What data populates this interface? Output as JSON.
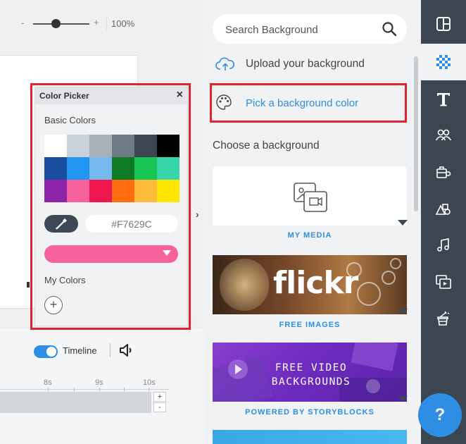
{
  "zoom": {
    "minus": "-",
    "plus": "+",
    "value": "100%",
    "level": 0.4
  },
  "color_picker": {
    "title": "Color Picker",
    "close": "×",
    "basic_colors_label": "Basic Colors",
    "swatches": [
      "#ffffff",
      "#c9d1d9",
      "#a7b1ba",
      "#6e7b86",
      "#3b4650",
      "#000000",
      "#1b4ea0",
      "#2196f3",
      "#74b8ee",
      "#0f7a25",
      "#18c552",
      "#37d6a8",
      "#8e24aa",
      "#f7629c",
      "#f0174e",
      "#ff6d10",
      "#ffbb3c",
      "#ffe600"
    ],
    "hex_value": "#F7629C",
    "selected_color": "#f7629c",
    "my_colors_label": "My Colors",
    "add": "+"
  },
  "timeline": {
    "label": "Timeline",
    "enabled": true,
    "ticks": [
      "8s",
      "9s",
      "10s"
    ],
    "plus": "+",
    "minus": "-"
  },
  "panel": {
    "search_placeholder": "Search Background",
    "upload_label": "Upload your background",
    "pick_label": "Pick a background color",
    "choose_label": "Choose a background",
    "tiles": {
      "media_caption": "MY MEDIA",
      "flickr_text": "flickr",
      "flickr_caption": "FREE IMAGES",
      "video_line1": "FREE VIDEO",
      "video_line2": "BACKGROUNDS",
      "video_caption": "POWERED BY STORYBLOCKS"
    }
  },
  "sidebar": {
    "items": [
      "layout-icon",
      "background-icon",
      "text-icon",
      "characters-icon",
      "props-icon",
      "shapes-icon",
      "music-icon",
      "video-icon",
      "effects-icon"
    ],
    "help": "?"
  },
  "colors": {
    "accent": "#2d8ee4",
    "highlight": "#e0232e",
    "sidebar": "#3c4651"
  }
}
